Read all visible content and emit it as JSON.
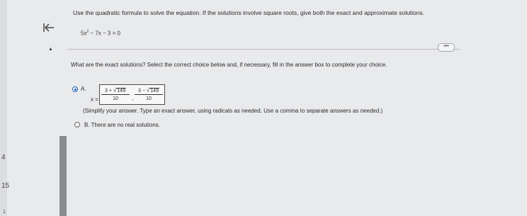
{
  "edge": {
    "n1": "4",
    "n2": "15",
    "n3": "1"
  },
  "instruction": "Use the quadratic formula to solve the equation. If the solutions involve square roots, give both the exact and approximate solutions.",
  "equation": {
    "lead": "5x",
    "exp": "2",
    "rest": " − 7x − 3 = 0"
  },
  "more_button": "•••",
  "question": "What are the exact solutions? Select the correct choice below and, if necessary, fill in the answer box to complete your choice.",
  "choice_a": {
    "letter": "A.",
    "x_label": "x =",
    "answer1": {
      "prefix": "3 + ",
      "radicand": "149",
      "den": "10"
    },
    "answer2": {
      "prefix": "3 − ",
      "radicand": "149",
      "den": "10"
    },
    "sep": ",",
    "sqrt_symbol": "√",
    "hint": "(Simplify your answer. Type an exact answer, using radicals as needed. Use a comma to separate answers as needed.)"
  },
  "choice_b": {
    "letter": "B.",
    "text": "There are no real solutions."
  },
  "accent_color": "#1c63b8"
}
